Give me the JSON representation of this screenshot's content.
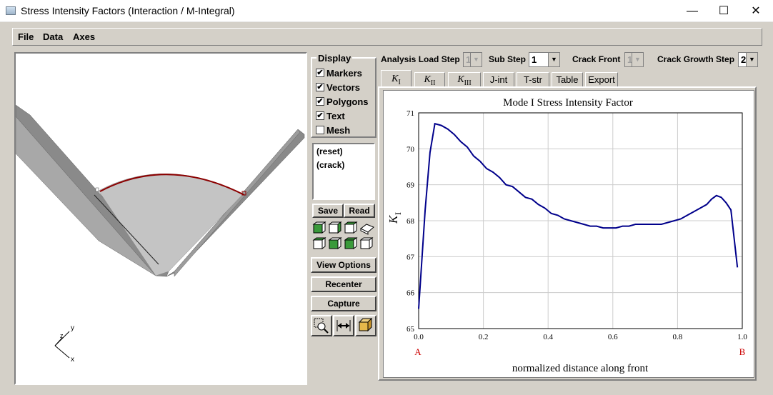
{
  "window": {
    "title": "Stress Intensity Factors (Interaction / M-Integral)"
  },
  "menu": {
    "items": [
      "File",
      "Data",
      "Axes"
    ]
  },
  "display": {
    "title": "Display",
    "options": [
      {
        "label": "Markers",
        "checked": true
      },
      {
        "label": "Vectors",
        "checked": true
      },
      {
        "label": "Polygons",
        "checked": true
      },
      {
        "label": "Text",
        "checked": true
      },
      {
        "label": "Mesh",
        "checked": false
      }
    ]
  },
  "views_list": {
    "items": [
      "(reset)",
      "(crack)"
    ]
  },
  "buttons": {
    "save": "Save",
    "read": "Read",
    "view_options": "View Options",
    "recenter": "Recenter",
    "capture": "Capture"
  },
  "axes_triad": {
    "y": "y",
    "x": "x",
    "z": "z"
  },
  "controls": {
    "analysis_load_step_label": "Analysis Load Step",
    "analysis_load_step_value": "1",
    "sub_step_label": "Sub Step",
    "sub_step_value": "1",
    "crack_front_label": "Crack Front",
    "crack_front_value": "1",
    "crack_growth_step_label": "Crack Growth Step",
    "crack_growth_step_value": "2"
  },
  "tabs": [
    {
      "k": "K",
      "sub": "I",
      "active": true
    },
    {
      "k": "K",
      "sub": "II",
      "active": false
    },
    {
      "k": "K",
      "sub": "III",
      "active": false
    },
    {
      "label": "J-int",
      "active": false
    },
    {
      "label": "T-str",
      "active": false
    },
    {
      "label": "Table",
      "active": false
    },
    {
      "label": "Export",
      "active": false
    }
  ],
  "colors": {
    "curve": "#00008b",
    "end_label": "#cc0000",
    "crack_arc": "#8b0000"
  },
  "chart_data": {
    "type": "line",
    "title": "Mode I Stress Intensity Factor",
    "xlabel": "normalized distance along front",
    "ylabel_main": "K",
    "ylabel_sub": "I",
    "xlim": [
      0,
      1.0
    ],
    "ylim": [
      65,
      71
    ],
    "xticks": [
      "0.0",
      "0.2",
      "0.4",
      "0.6",
      "0.8",
      "1.0"
    ],
    "yticks": [
      "65",
      "66",
      "67",
      "68",
      "69",
      "70",
      "71"
    ],
    "end_labels": {
      "start": "A",
      "end": "B"
    },
    "grid": true,
    "series": [
      {
        "x": [
          0.0,
          0.02,
          0.035,
          0.05,
          0.07,
          0.09,
          0.11,
          0.13,
          0.15,
          0.17,
          0.19,
          0.21,
          0.23,
          0.25,
          0.27,
          0.29,
          0.31,
          0.33,
          0.35,
          0.37,
          0.39,
          0.41,
          0.43,
          0.45,
          0.47,
          0.49,
          0.51,
          0.53,
          0.55,
          0.57,
          0.59,
          0.61,
          0.63,
          0.65,
          0.67,
          0.69,
          0.71,
          0.73,
          0.75,
          0.77,
          0.79,
          0.81,
          0.83,
          0.85,
          0.87,
          0.89,
          0.905,
          0.92,
          0.935,
          0.95,
          0.965,
          0.985
        ],
        "y": [
          65.55,
          68.3,
          69.9,
          70.7,
          70.65,
          70.55,
          70.4,
          70.2,
          70.05,
          69.8,
          69.65,
          69.45,
          69.35,
          69.2,
          69.0,
          68.95,
          68.8,
          68.65,
          68.6,
          68.45,
          68.35,
          68.2,
          68.15,
          68.05,
          68.0,
          67.95,
          67.9,
          67.85,
          67.85,
          67.8,
          67.8,
          67.8,
          67.85,
          67.85,
          67.9,
          67.9,
          67.9,
          67.9,
          67.9,
          67.95,
          68.0,
          68.05,
          68.15,
          68.25,
          68.35,
          68.45,
          68.6,
          68.7,
          68.65,
          68.5,
          68.3,
          66.7
        ]
      }
    ]
  }
}
